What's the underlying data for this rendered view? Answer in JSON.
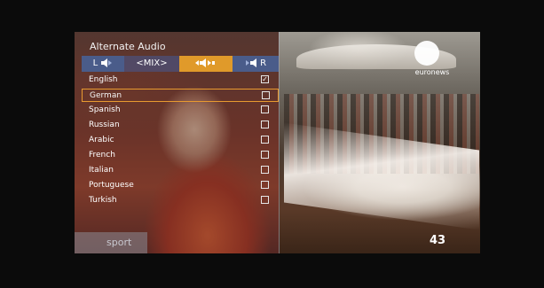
{
  "menu": {
    "title": "Alternate Audio",
    "channels": [
      {
        "label": "L",
        "icon": "speaker-left-icon"
      },
      {
        "label": "<MIX>",
        "icon": ""
      },
      {
        "label": "",
        "icon": "speaker-both-icon"
      },
      {
        "label": "R",
        "icon": "speaker-right-icon"
      }
    ],
    "selected_channel": 2,
    "languages": [
      {
        "label": "English",
        "checked": true,
        "check_mark": "✓"
      },
      {
        "label": "German",
        "checked": false,
        "check_mark": ""
      },
      {
        "label": "Spanish",
        "checked": false,
        "check_mark": ""
      },
      {
        "label": "Russian",
        "checked": false,
        "check_mark": ""
      },
      {
        "label": "Arabic",
        "checked": false,
        "check_mark": ""
      },
      {
        "label": "French",
        "checked": false,
        "check_mark": ""
      },
      {
        "label": "Italian",
        "checked": false,
        "check_mark": ""
      },
      {
        "label": "Portuguese",
        "checked": false,
        "check_mark": ""
      },
      {
        "label": "Turkish",
        "checked": false,
        "check_mark": ""
      }
    ],
    "focused_language": 1,
    "tab_label": "sport"
  },
  "broadcast": {
    "logo_text": "euronews",
    "channel_number": "43"
  },
  "colors": {
    "highlight": "#e89a30",
    "channel_active": "#e09a2a",
    "channel_bar": "#4a5c8a"
  }
}
